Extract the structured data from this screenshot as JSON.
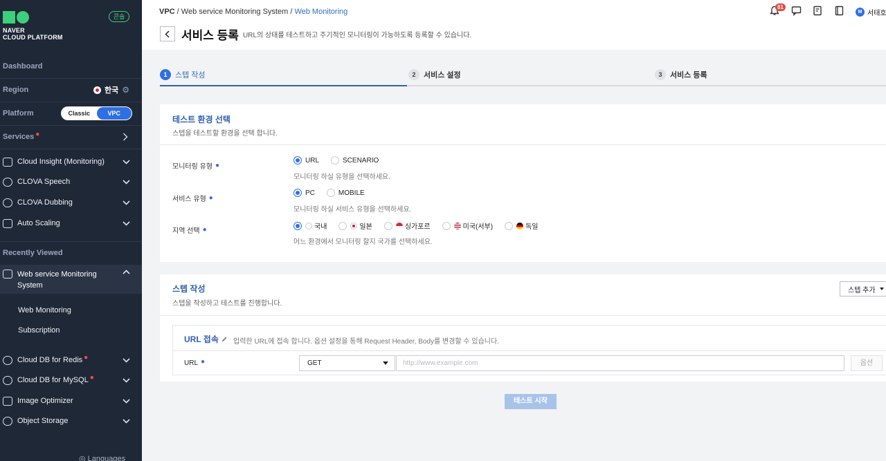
{
  "sidebar": {
    "logo_line1": "NAVER",
    "logo_line2": "CLOUD PLATFORM",
    "console_badge": "콘솔",
    "dashboard": "Dashboard",
    "region_label": "Region",
    "region_value": "한국",
    "platform_label": "Platform",
    "platform_options": [
      "Classic",
      "VPC"
    ],
    "platform_selected": "VPC",
    "services_label": "Services",
    "favorites": [
      {
        "label": "Cloud Insight (Monitoring)",
        "icon": "cloud-insight-icon"
      },
      {
        "label": "CLOVA Speech",
        "icon": "clova-speech-icon"
      },
      {
        "label": "CLOVA Dubbing",
        "icon": "clova-dubbing-icon"
      },
      {
        "label": "Auto Scaling",
        "icon": "auto-scaling-icon"
      }
    ],
    "recently_viewed_label": "Recently Viewed",
    "recent_expanded": {
      "label_line1": "Web service Monitoring",
      "label_line2": "System",
      "icon": "monitor-icon"
    },
    "recent_sub_links": [
      "Web Monitoring",
      "Subscription"
    ],
    "recent_items": [
      {
        "label": "Cloud DB for Redis",
        "icon": "cloud-db-icon",
        "dot": true
      },
      {
        "label": "Cloud DB for MySQL",
        "icon": "cloud-db-icon",
        "dot": true
      },
      {
        "label": "Image Optimizer",
        "icon": "image-optimizer-icon",
        "dot": false
      },
      {
        "label": "Object Storage",
        "icon": "object-storage-icon",
        "dot": false
      }
    ],
    "languages": "Languages"
  },
  "header": {
    "breadcrumb": [
      "VPC",
      "Web service Monitoring System",
      "Web Monitoring"
    ],
    "title": "서비스 등록",
    "description": "URL의 상태를 테스트하고 주기적인 모니터링이 가능하도록 등록할 수 있습니다.",
    "notification_count": "81",
    "user_initial": "M",
    "user_name": "서태호"
  },
  "stepper": [
    {
      "num": "1",
      "label": "스텝 작성",
      "active": true
    },
    {
      "num": "2",
      "label": "서비스 설정",
      "active": false
    },
    {
      "num": "3",
      "label": "서비스 등록",
      "active": false
    }
  ],
  "env_panel": {
    "title": "테스트 환경 선택",
    "subtitle": "스텝을 테스트할 환경을 선택 합니다.",
    "monitoring_type": {
      "label": "모니터링 유형",
      "options": [
        "URL",
        "SCENARIO"
      ],
      "selected": "URL",
      "hint": "모니터링 하실 유형을 선택하세요."
    },
    "service_type": {
      "label": "서비스 유형",
      "options": [
        "PC",
        "MOBILE"
      ],
      "selected": "PC",
      "hint": "모니터링 하실 서비스 유형을 선택하세요."
    },
    "region": {
      "label": "지역 선택",
      "options": [
        "국내",
        "일본",
        "싱가포르",
        "미국(서부)",
        "독일"
      ],
      "selected": "국내",
      "hint": "어느 환경에서 모니터링 할지 국가를 선택하세요."
    }
  },
  "step_panel": {
    "title": "스텝 작성",
    "subtitle": "스텝을 작성하고 테스트를 진행합니다.",
    "add_step_button": "스텝 추가",
    "url_box": {
      "title": "URL 접속",
      "description": "입력한 URL에 접속 합니다. 옵션 설정을 통해 Request Header, Body를 변경할 수 있습니다.",
      "url_label": "URL",
      "method": "GET",
      "url_placeholder": "http://www.example.com",
      "url_value": "",
      "option_button": "옵션"
    }
  },
  "start_button": "테스트 시작",
  "colors": {
    "sidebar_bg": "#1f2836",
    "accent": "#2f6fe4",
    "brand_green": "#3dd07a",
    "link_blue": "#2f5fb0"
  }
}
